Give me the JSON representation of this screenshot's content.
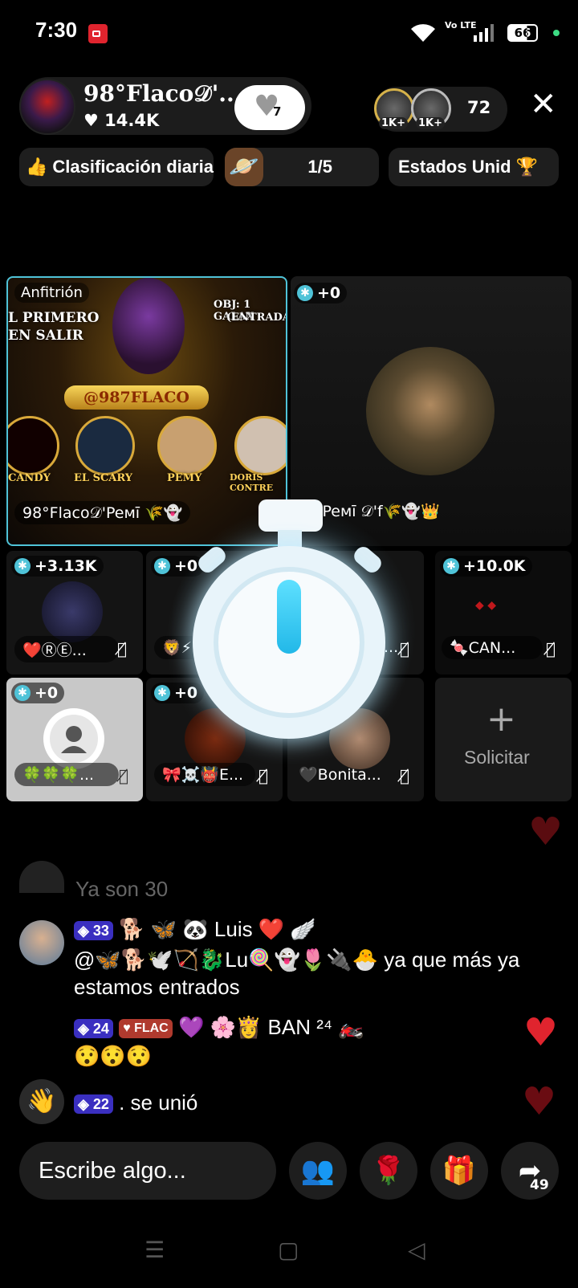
{
  "status_bar": {
    "time": "7:30",
    "volte": "Vo LTE",
    "battery": "66"
  },
  "host": {
    "name": "98°Flaco𝒟'...",
    "likes": "14.4K",
    "follow_count": "7"
  },
  "viewers": {
    "badge_1": "1K+",
    "badge_2": "1K+",
    "count": "72"
  },
  "chips": {
    "daily_rank": "Clasificación diaria",
    "progress": "1/5",
    "region": "Estados Unid"
  },
  "grid": {
    "host_tile": {
      "label": "Anfitrión",
      "poster_line1": "L PRIMERO",
      "poster_line2": "EN SALIR",
      "poster_obj": "OBJ: 1 GALAX",
      "poster_obj2": "(ENTRADA)",
      "poster_handle": "@987FLACO",
      "poster_names": [
        "CANDY",
        "EL SCARY",
        "PEMY",
        "DORIS CONTRE"
      ],
      "name": "98°Flaco𝒟'Peᴍī 🌾👻"
    },
    "guest_tile": {
      "score": "+0",
      "name": "°Peᴍī 𝒟'f🌾👻👑"
    },
    "row1": [
      {
        "score": "+3.13K",
        "name": "❤️ⓇⒺ..."
      },
      {
        "score": "+0",
        "name": "🦁⚡..."
      },
      {
        "score": "",
        "name": "..."
      },
      {
        "score": "+10.0K",
        "name": "🍬CAN..."
      }
    ],
    "row2": [
      {
        "score": "+0",
        "name": "🍀🍀🍀..."
      },
      {
        "score": "+0",
        "name": "🎀☠️👹E..."
      },
      {
        "score": "",
        "name": "🖤Bonita..."
      }
    ],
    "request": "Solicitar"
  },
  "chat": {
    "faded": "Ya son 30",
    "msg1": {
      "level": "33",
      "name": "🐕 🦋 🐼 Luis ❤️ 🪽",
      "text_1": "@🦋🐕🕊️🏹🐉Lu🍭👻🌷🔌🐣 ya que más ya",
      "text_2": "estamos entrados"
    },
    "msg2": {
      "level": "24",
      "badge": "FLAC",
      "name": "💜 🌸👸 BAN ²⁴ 🏍️",
      "text": "😯😯😯"
    },
    "msg3": {
      "level": "22",
      "text": ". se unió"
    }
  },
  "bottom_bar": {
    "input_placeholder": "Escribe algo...",
    "share_count": "49"
  },
  "colors": {
    "accent_cyan": "#4fc3d8",
    "level_badge": "#3a2fc0",
    "heart_red": "#e0242e"
  }
}
